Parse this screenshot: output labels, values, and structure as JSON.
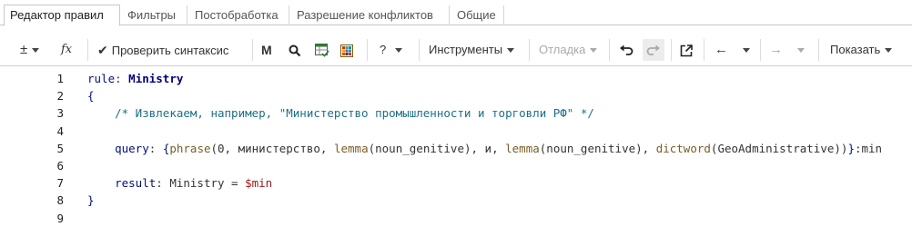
{
  "tabs": [
    {
      "label": "Редактор правил",
      "active": true
    },
    {
      "label": "Фильтры",
      "active": false
    },
    {
      "label": "Постобработка",
      "active": false
    },
    {
      "label": "Разрешение конфликтов",
      "active": false
    },
    {
      "label": "Общие",
      "active": false
    }
  ],
  "toolbar": {
    "plusminus_label": "±",
    "fx_label": "fx",
    "check_syntax_label": "Проверить синтаксис",
    "bold_label": "M",
    "help_label": "?",
    "tools_label": "Инструменты",
    "debug_label": "Отладка",
    "show_label": "Показать"
  },
  "editor": {
    "lines": [
      {
        "n": "1",
        "tokens": [
          [
            "kw",
            "rule"
          ],
          [
            "op",
            ": "
          ],
          [
            "kw2",
            "Ministry"
          ]
        ]
      },
      {
        "n": "2",
        "tokens": [
          [
            "kw",
            "{"
          ]
        ]
      },
      {
        "n": "3",
        "tokens": [
          [
            "op",
            "    "
          ],
          [
            "cm",
            "/* Извлекаем, например, \"Министерство промышленности и торговли РФ\" */"
          ]
        ]
      },
      {
        "n": "4",
        "tokens": []
      },
      {
        "n": "5",
        "tokens": [
          [
            "op",
            "    "
          ],
          [
            "kw",
            "query"
          ],
          [
            "op",
            ": "
          ],
          [
            "kw",
            "{"
          ],
          [
            "fn",
            "phrase"
          ],
          [
            "op",
            "(0, министерство, "
          ],
          [
            "fn",
            "lemma"
          ],
          [
            "op",
            "(noun_genitive), и, "
          ],
          [
            "fn",
            "lemma"
          ],
          [
            "op",
            "(noun_genitive), "
          ],
          [
            "fn",
            "dictword"
          ],
          [
            "op",
            "(GeoAdministrative))"
          ],
          [
            "kw",
            "}"
          ],
          [
            "op",
            ":min"
          ]
        ]
      },
      {
        "n": "6",
        "tokens": []
      },
      {
        "n": "7",
        "tokens": [
          [
            "op",
            "    "
          ],
          [
            "kw",
            "result"
          ],
          [
            "op",
            ": Ministry = "
          ],
          [
            "var",
            "$min"
          ]
        ]
      },
      {
        "n": "8",
        "tokens": [
          [
            "kw",
            "}"
          ]
        ]
      },
      {
        "n": "9",
        "tokens": []
      }
    ]
  },
  "colors": {
    "keyword": "#001080",
    "comment": "#1e6f86",
    "function": "#795e26",
    "variable": "#a31515"
  }
}
